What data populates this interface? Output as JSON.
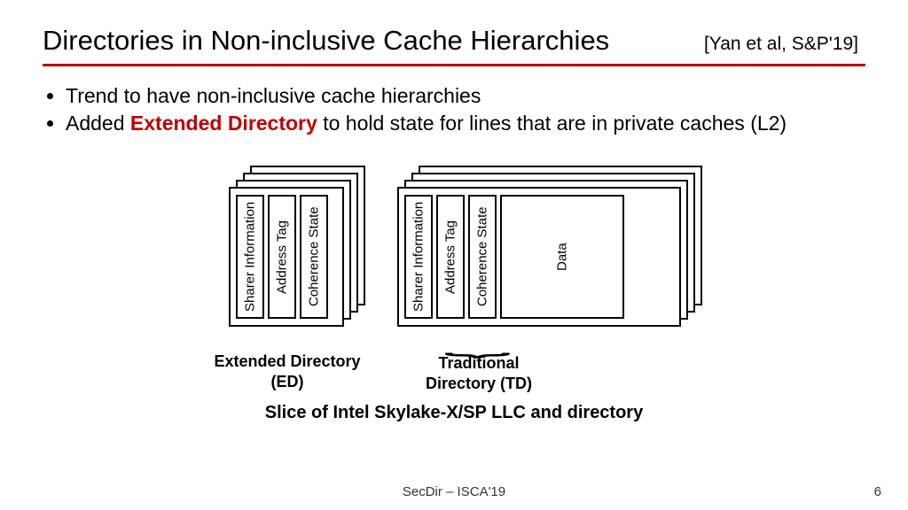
{
  "header": {
    "title": "Directories in Non-inclusive Cache Hierarchies",
    "citation": "[Yan et al, S&P'19]"
  },
  "bullets": {
    "b1": "Trend to have non-inclusive cache hierarchies",
    "b2_pre": "Added ",
    "b2_emph": "Extended Directory",
    "b2_post": " to hold state for lines that are in private caches (L2)"
  },
  "columns": {
    "sharer": "Sharer Information",
    "tag": "Address Tag",
    "coh": "Coherence State",
    "data": "Data"
  },
  "labels": {
    "ed": "Extended Directory (ED)",
    "td": "Traditional Directory (TD)",
    "caption": "Slice of Intel Skylake-X/SP LLC and directory"
  },
  "footer": {
    "venue": "SecDir – ISCA'19",
    "page": "6"
  }
}
